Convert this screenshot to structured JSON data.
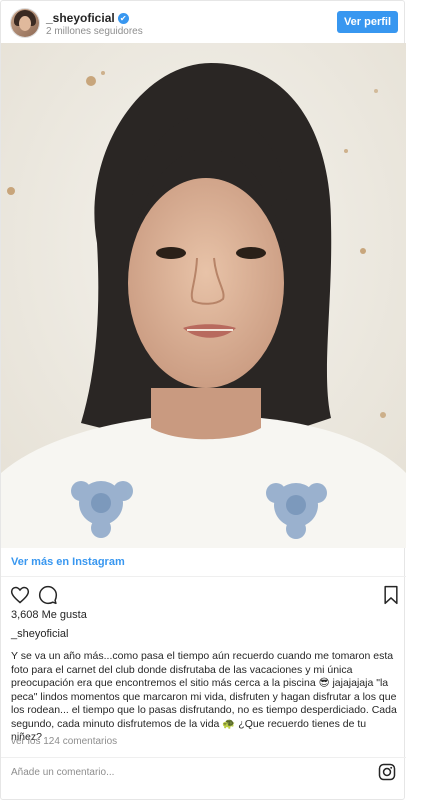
{
  "header": {
    "username": "_sheyoficial",
    "verified_mark": "✔",
    "followers": "2 millones seguidores",
    "follow_button": "Ver perfil"
  },
  "post": {
    "view_more": "Ver más en Instagram",
    "likes": "3,608 Me gusta",
    "owner": "_sheyoficial",
    "caption": "Y se va un año más...como pasa el tiempo aún recuerdo cuando me tomaron esta foto para el carnet del club donde disfrutaba de las vacaciones y mi única preocupación era que encontremos el sitio más cerca a la piscina 😎 jajajajaja \"la peca\" lindos momentos que marcaron mi vida, disfruten y hagan disfrutar a los que los rodean... el tiempo que lo pasas disfrutando, no es tiempo desperdiciado. Cada segundo, cada minuto disfrutemos de la vida 🐢 ¿Que recuerdo tienes de tu niñez?",
    "view_comments": "ver los 124 comentarios",
    "comment_placeholder": "Añade un comentario..."
  },
  "icons": {
    "like": "heart-icon",
    "comment": "comment-icon",
    "save": "bookmark-icon",
    "instagram": "instagram-icon"
  },
  "colors": {
    "accent": "#3897f0",
    "muted": "#8e8e8e",
    "text": "#262626"
  }
}
